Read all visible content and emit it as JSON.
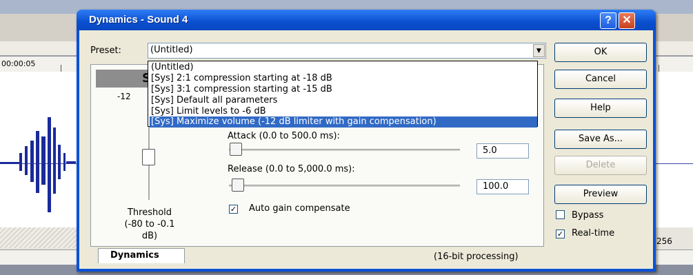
{
  "background_app": {
    "ruler_time": "00:00:05",
    "side_value": "256"
  },
  "dialog": {
    "title": "Dynamics - Sound 4",
    "title_buttons": {
      "help": "?",
      "close": "✕"
    },
    "preset": {
      "label": "Preset:",
      "value": "(Untitled)",
      "options": [
        "(Untitled)",
        "[Sys] 2:1 compression starting at -18 dB",
        "[Sys] 3:1 compression starting at -15 dB",
        "[Sys] Default all parameters",
        "[Sys] Limit levels to -6 dB",
        "[Sys] Maximize volume (-12 dB limiter with gain compensation)"
      ],
      "highlighted_index": 5
    },
    "side_buttons": {
      "ok": "OK",
      "cancel": "Cancel",
      "help": "Help",
      "save_as": "Save As...",
      "delete": "Delete",
      "preview": "Preview"
    },
    "side_checks": {
      "bypass": {
        "label": "Bypass",
        "checked": false
      },
      "realtime": {
        "label": "Real-time",
        "checked": true
      }
    },
    "panel": {
      "partial_s": "S",
      "partial_neg": "-12",
      "threshold_label": "Threshold",
      "threshold_range": "(-80 to -0.1 dB)",
      "attack_label": "Attack (0.0 to 500.0 ms):",
      "attack_value": "5.0",
      "release_label": "Release (0.0 to 5,000.0 ms):",
      "release_value": "100.0",
      "auto_gain_label": "Auto gain compensate",
      "auto_gain_checked": true,
      "tab_label": "Dynamics",
      "processing": "(16-bit processing)"
    }
  }
}
